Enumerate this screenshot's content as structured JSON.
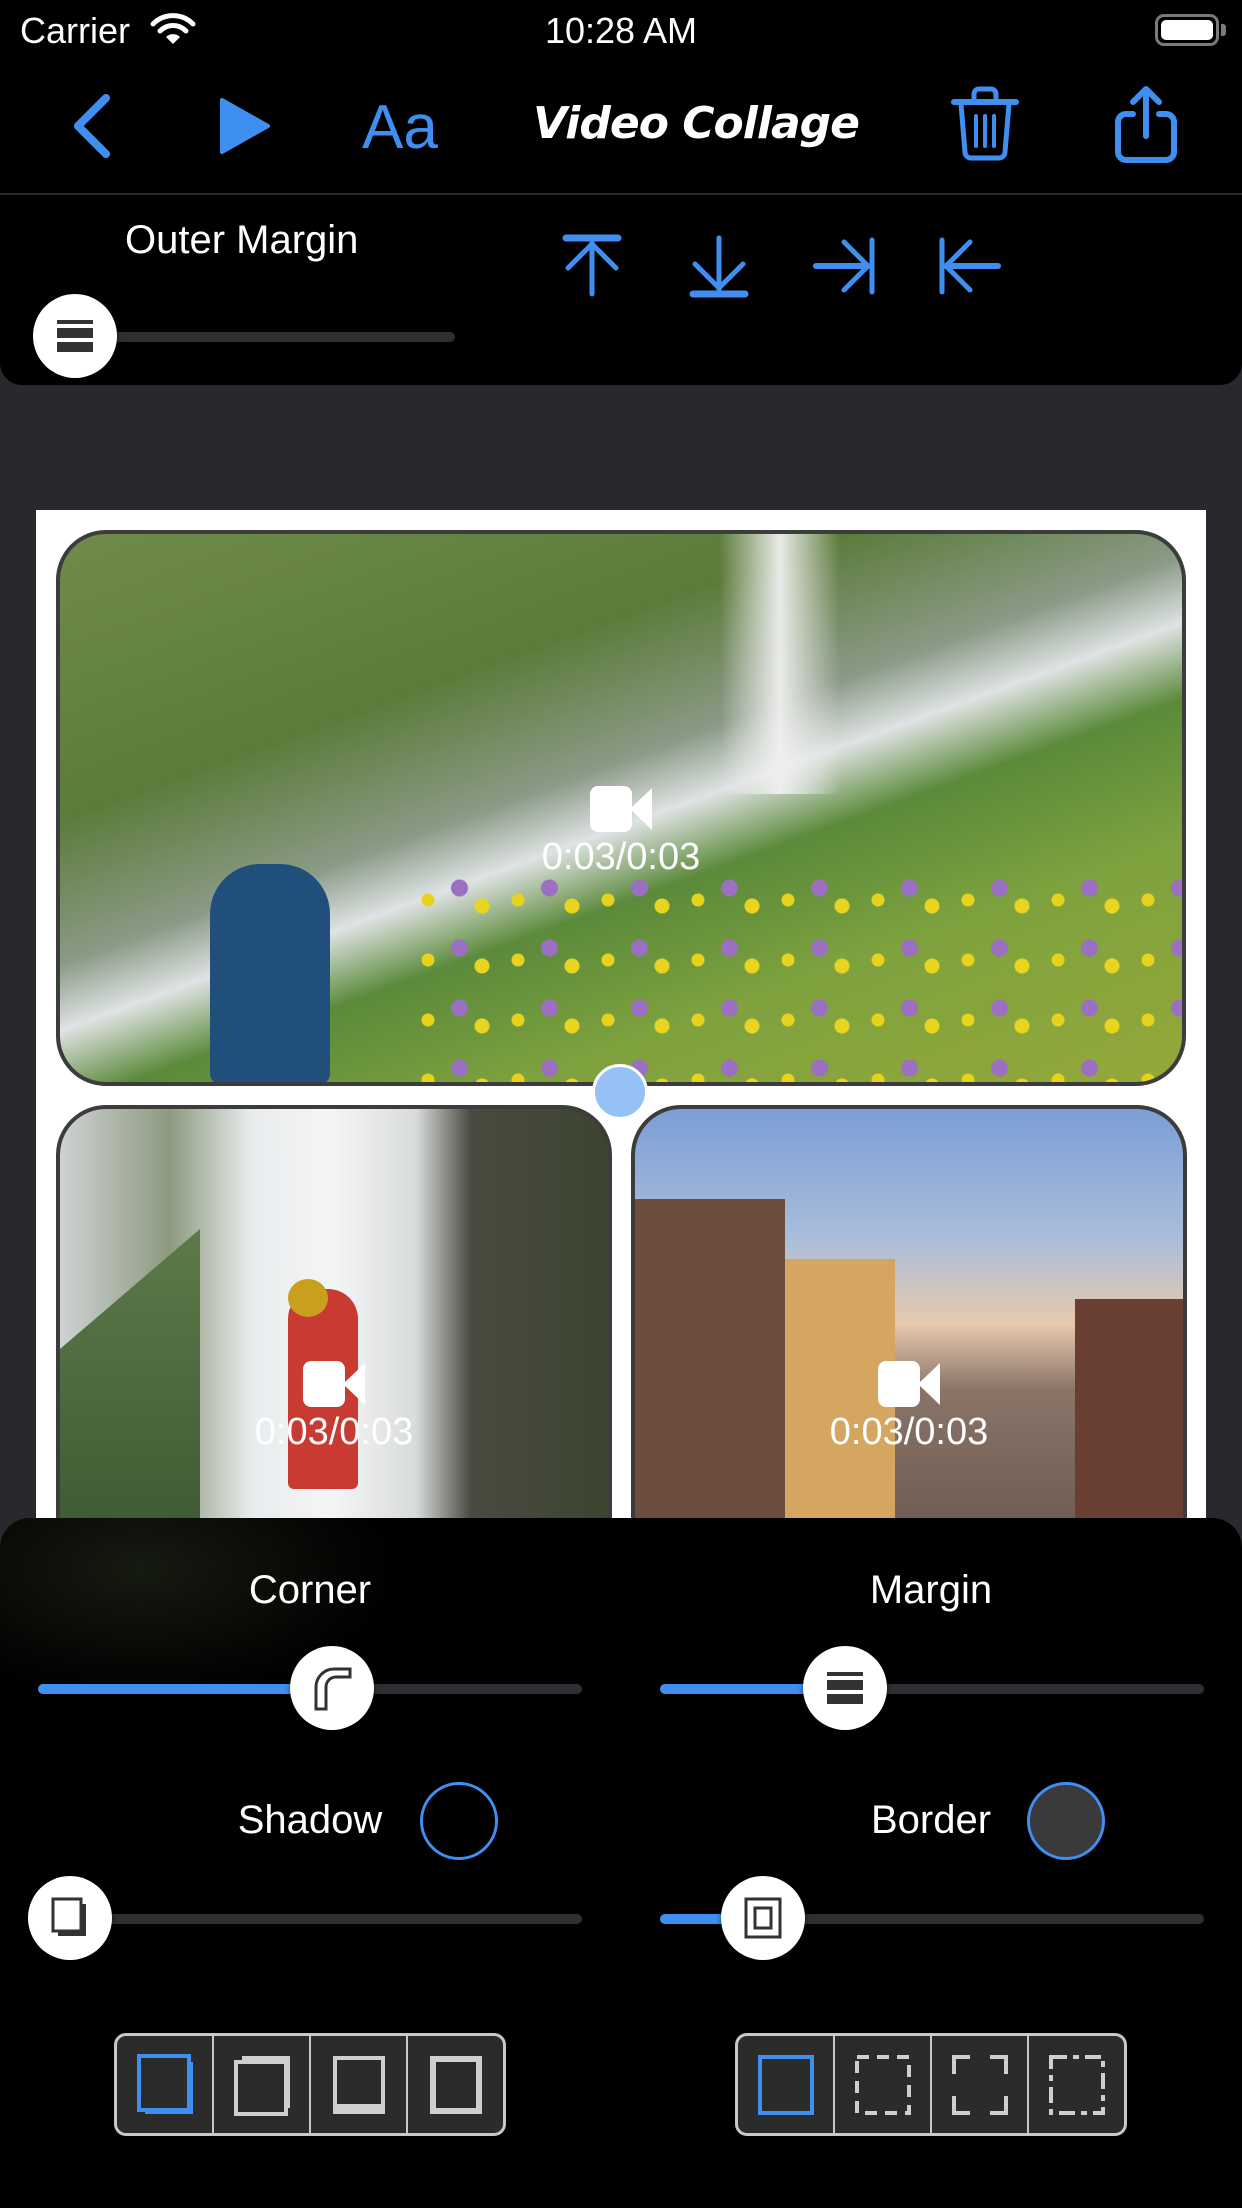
{
  "status_bar": {
    "carrier": "Carrier",
    "time": "10:28 AM",
    "wifi_icon": "wifi-icon",
    "battery_icon": "battery-icon",
    "battery_level": 1.0
  },
  "nav": {
    "title": "Video Collage",
    "back_icon": "chevron-left-icon",
    "play_icon": "play-icon",
    "text_button_label": "Aa",
    "delete_icon": "trash-icon",
    "share_icon": "share-icon"
  },
  "outer_margin": {
    "label": "Outer Margin",
    "value": 0.0,
    "icons": [
      "arrow-up-to-line-icon",
      "arrow-down-to-line-icon",
      "arrow-right-to-line-icon",
      "arrow-left-to-line-icon"
    ]
  },
  "collage": {
    "tiles": [
      {
        "name": "waterfall-hiker",
        "media_icon": "video-camera-icon",
        "duration": "0:03/0:03"
      },
      {
        "name": "waterfall-climber",
        "media_icon": "video-camera-icon",
        "duration": "0:03/0:03"
      },
      {
        "name": "city-skyline",
        "media_icon": "video-camera-icon",
        "duration": "0:03/0:03"
      }
    ]
  },
  "controls": {
    "corner": {
      "label": "Corner",
      "value": 0.54,
      "thumb_icon": "rounded-corner-icon"
    },
    "margin": {
      "label": "Margin",
      "value": 0.34,
      "thumb_icon": "margin-rows-icon"
    },
    "shadow": {
      "label": "Shadow",
      "value": 0.0,
      "thumb_icon": "shadow-box-icon",
      "color": "#000000"
    },
    "border": {
      "label": "Border",
      "value": 0.19,
      "thumb_icon": "inner-border-icon",
      "color": "#3a3a3c"
    },
    "shadow_styles": {
      "selected": 0,
      "options": [
        "shadow-bottom-right-icon",
        "shadow-top-right-icon",
        "shadow-bottom-icon",
        "shadow-all-around-icon"
      ]
    },
    "border_styles": {
      "selected": 0,
      "options": [
        "border-solid-icon",
        "border-dashed-icon",
        "border-corners-icon",
        "border-dash-dot-icon"
      ]
    }
  },
  "colors": {
    "accent": "#3f8ff0",
    "panel": "#000000",
    "background": "#28292d",
    "track": "#2e2f33"
  }
}
